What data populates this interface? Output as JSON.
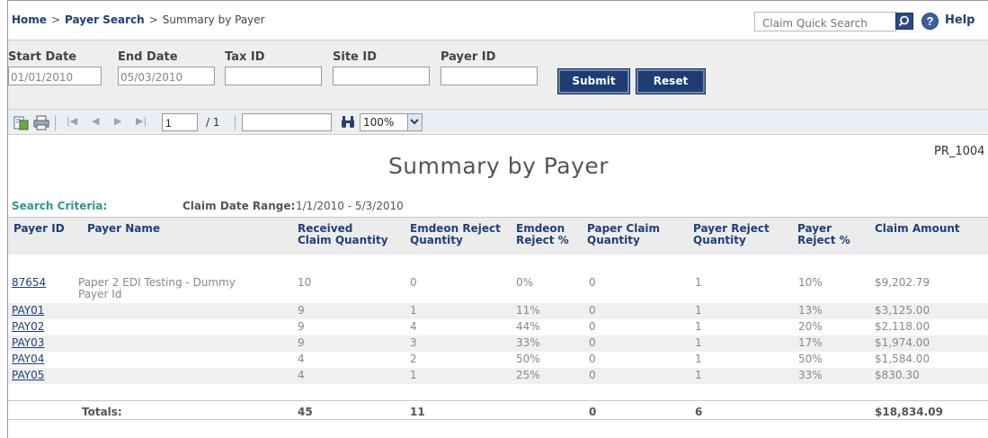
{
  "breadcrumb": {
    "home": "Home",
    "sep1": ">",
    "payer_search": "Payer Search",
    "sep2": ">",
    "current": "Summary by Payer"
  },
  "header": {
    "quick_search_placeholder": "Claim Quick Search",
    "help_glyph": "?",
    "help_label": "Help"
  },
  "criteria": {
    "start_date_label": "Start Date",
    "start_date_value": "01/01/2010",
    "end_date_label": "End Date",
    "end_date_value": "05/03/2010",
    "tax_id_label": "Tax ID",
    "tax_id_value": "",
    "site_id_label": "Site ID",
    "site_id_value": "",
    "payer_id_label": "Payer ID",
    "payer_id_value": "",
    "submit_label": "Submit",
    "reset_label": "Reset"
  },
  "toolbar": {
    "page_number": "1",
    "page_total": "/ 1",
    "find_value": "",
    "zoom": "100%"
  },
  "report": {
    "code": "PR_1004",
    "title": "Summary by Payer",
    "search_criteria_label": "Search Criteria:",
    "date_range_label": "Claim Date Range:",
    "date_range_value": "1/1/2010 - 5/3/2010"
  },
  "table": {
    "columns": [
      "Payer ID",
      "Payer Name",
      "Received\nClaim Quantity",
      "Emdeon Reject\nQuantity",
      "Emdeon\nReject %",
      "Paper Claim\nQuantity",
      "Payer Reject\nQuantity",
      "Payer\nReject %",
      "Claim Amount"
    ],
    "rows": [
      {
        "payer_id": "87654",
        "payer_name": "Paper 2 EDI Testing - Dummy Payer Id",
        "received": "10",
        "emdeon_reject_qty": "0",
        "emdeon_reject_pct": "0%",
        "paper_claim_qty": "0",
        "payer_reject_qty": "1",
        "payer_reject_pct": "10%",
        "claim_amount": "$9,202.79"
      },
      {
        "payer_id": "PAY01",
        "payer_name": "",
        "received": "9",
        "emdeon_reject_qty": "1",
        "emdeon_reject_pct": "11%",
        "paper_claim_qty": "0",
        "payer_reject_qty": "1",
        "payer_reject_pct": "13%",
        "claim_amount": "$3,125.00"
      },
      {
        "payer_id": "PAY02",
        "payer_name": "",
        "received": "9",
        "emdeon_reject_qty": "4",
        "emdeon_reject_pct": "44%",
        "paper_claim_qty": "0",
        "payer_reject_qty": "1",
        "payer_reject_pct": "20%",
        "claim_amount": "$2,118.00"
      },
      {
        "payer_id": "PAY03",
        "payer_name": "",
        "received": "9",
        "emdeon_reject_qty": "3",
        "emdeon_reject_pct": "33%",
        "paper_claim_qty": "0",
        "payer_reject_qty": "1",
        "payer_reject_pct": "17%",
        "claim_amount": "$1,974.00"
      },
      {
        "payer_id": "PAY04",
        "payer_name": "",
        "received": "4",
        "emdeon_reject_qty": "2",
        "emdeon_reject_pct": "50%",
        "paper_claim_qty": "0",
        "payer_reject_qty": "1",
        "payer_reject_pct": "50%",
        "claim_amount": "$1,584.00"
      },
      {
        "payer_id": "PAY05",
        "payer_name": "",
        "received": "4",
        "emdeon_reject_qty": "1",
        "emdeon_reject_pct": "25%",
        "paper_claim_qty": "0",
        "payer_reject_qty": "1",
        "payer_reject_pct": "33%",
        "claim_amount": "$830.30"
      }
    ],
    "totals": {
      "label": "Totals:",
      "received": "45",
      "emdeon_reject_qty": "11",
      "paper_claim_qty": "0",
      "payer_reject_qty": "6",
      "claim_amount": "$18,834.09"
    }
  },
  "colors": {
    "link": "#1f3f7a",
    "accent_teal": "#2c9a8a",
    "button": "#1d3c74"
  },
  "icons": [
    "search-icon",
    "help-icon",
    "export-icon",
    "print-icon",
    "first-page-icon",
    "prev-page-icon",
    "next-page-icon",
    "last-page-icon",
    "find-binoculars-icon",
    "dropdown-arrow-icon"
  ]
}
